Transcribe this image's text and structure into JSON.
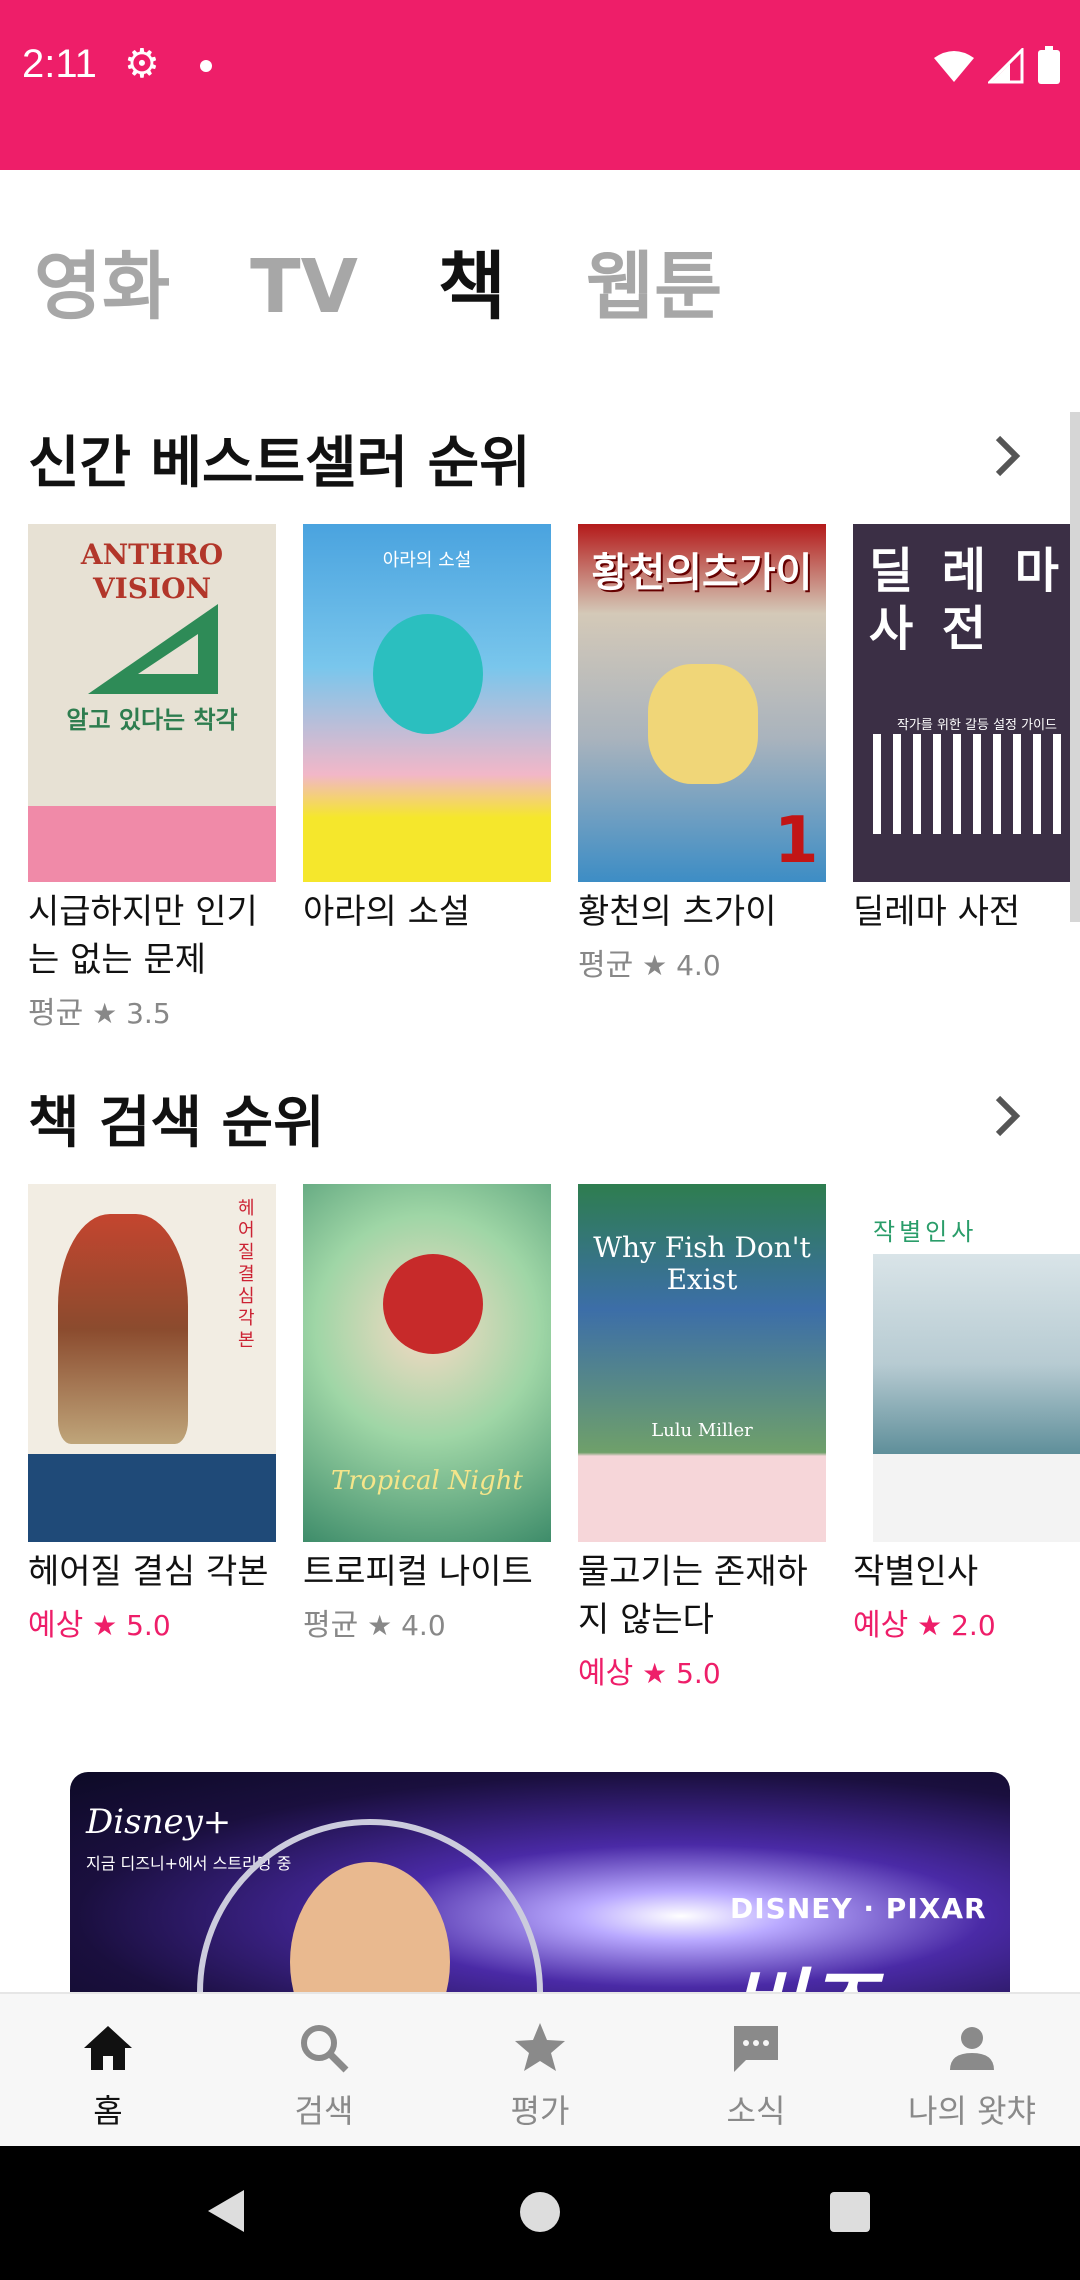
{
  "status_bar": {
    "time": "2:11"
  },
  "tabs": [
    {
      "label": "영화"
    },
    {
      "label": "TV"
    },
    {
      "label": "책"
    },
    {
      "label": "웹툰"
    }
  ],
  "sections": [
    {
      "title": "신간 베스트셀러 순위",
      "books": [
        {
          "title_line1": "시급하지만 인기",
          "title_line2": "는 없는 문제",
          "meta_label": "평균",
          "rating": "★ 3.5",
          "cover_text": "ANTHRO VISION",
          "cover_sub": "알고 있다는 착각"
        },
        {
          "title_line1": "아라의 소설",
          "title_line2": "",
          "meta_label": "",
          "rating": "",
          "cover_text": "아라의 소설"
        },
        {
          "title_line1": "황천의 츠가이",
          "title_line2": "",
          "meta_label": "평균",
          "rating": "★ 4.0",
          "cover_text": "황천의츠가이"
        },
        {
          "title_line1": "딜레마 사전",
          "title_line2": "",
          "meta_label": "",
          "rating": "",
          "cover_text": "딜 레 마 사 전",
          "cover_sub": "작가를 위한 갈등 설정 가이드"
        }
      ]
    },
    {
      "title": "책 검색 순위",
      "books": [
        {
          "title_line1": "헤어질 결심 각본",
          "title_line2": "",
          "meta_label": "예상",
          "rating": "★ 5.0",
          "cover_text": "헤어질 결심 각본"
        },
        {
          "title_line1": "트로피컬 나이트",
          "title_line2": "",
          "meta_label": "평균",
          "rating": "★ 4.0",
          "cover_text": "Tropical Night"
        },
        {
          "title_line1": "물고기는 존재하",
          "title_line2": "지 않는다",
          "meta_label": "예상",
          "rating": "★ 5.0",
          "cover_text": "Why Fish Don't Exist",
          "cover_sub": "Lulu Miller"
        },
        {
          "title_line1": "작별인사",
          "title_line2": "",
          "meta_label": "예상",
          "rating": "★ 2.0",
          "cover_text": "작별인사"
        }
      ]
    }
  ],
  "banner": {
    "logo": "Disney+",
    "sub": "지금 디즈니+에서 스트리밍 중",
    "brand": "DISNEY · PIXAR",
    "title": "버즈"
  },
  "bottom_nav": [
    {
      "label": "홈"
    },
    {
      "label": "검색"
    },
    {
      "label": "평가"
    },
    {
      "label": "소식"
    },
    {
      "label": "나의 왓챠"
    }
  ],
  "colors": {
    "accent": "#ee1e69"
  }
}
